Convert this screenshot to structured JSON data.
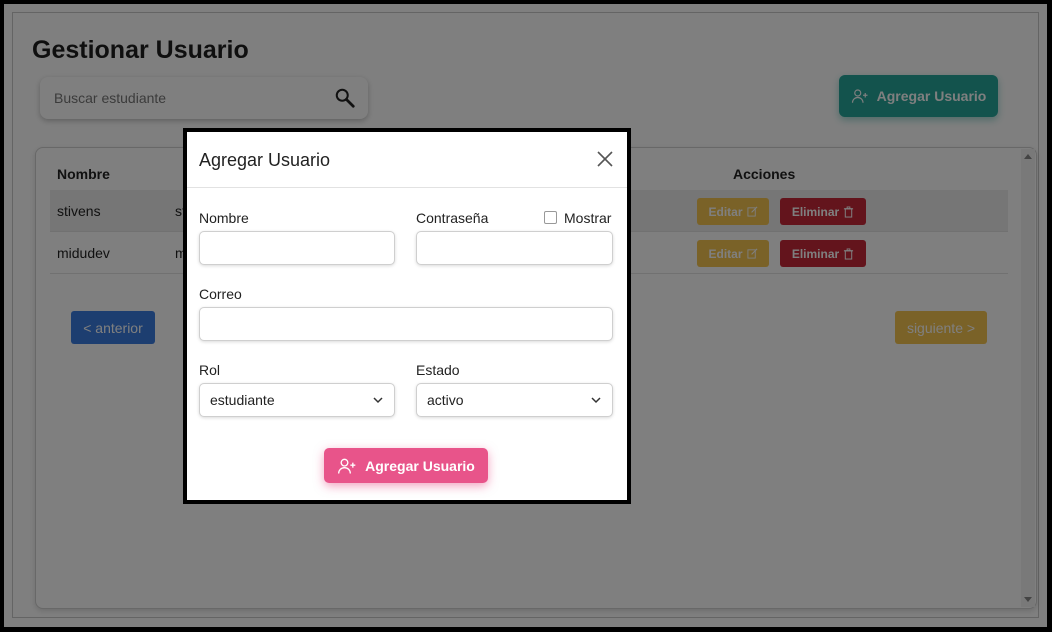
{
  "page": {
    "title": "Gestionar Usuario",
    "search_placeholder": "Buscar estudiante",
    "add_button_label": "Agregar Usuario"
  },
  "table": {
    "headers": {
      "name": "Nombre",
      "actions": "Acciones"
    },
    "rows": [
      {
        "name": "stivens",
        "col2": "sti",
        "edit": "Editar",
        "delete": "Eliminar"
      },
      {
        "name": "midudev",
        "col2": "m",
        "edit": "Editar",
        "delete": "Eliminar"
      }
    ]
  },
  "pagination": {
    "prev": "< anterior",
    "next": "siguiente >"
  },
  "modal": {
    "title": "Agregar Usuario",
    "fields": {
      "name_label": "Nombre",
      "password_label": "Contraseña",
      "show_label": "Mostrar",
      "email_label": "Correo",
      "role_label": "Rol",
      "role_value": "estudiante",
      "status_label": "Estado",
      "status_value": "activo"
    },
    "submit_label": "Agregar Usuario"
  },
  "colors": {
    "teal": "#26a69a",
    "pink": "#e8548a",
    "yellow": "#f5c451",
    "red": "#c62839",
    "blue": "#3b7de0"
  }
}
